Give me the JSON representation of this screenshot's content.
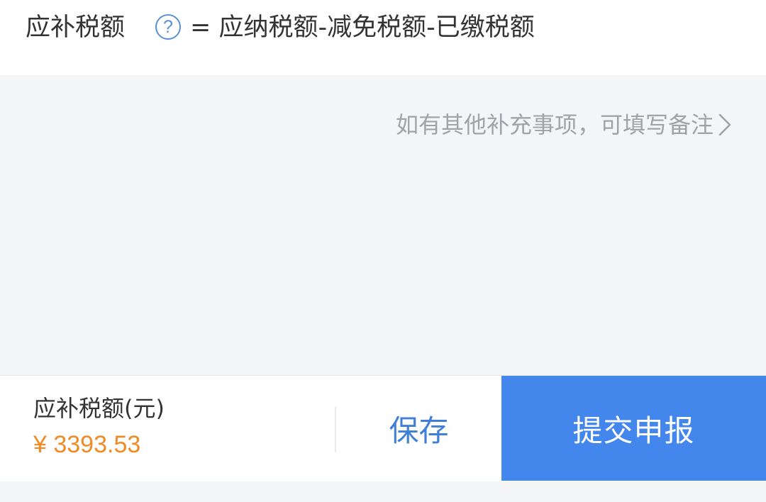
{
  "formula": {
    "title": "应补税额",
    "help_symbol": "?",
    "expression": "= 应纳税额-减免税额-已缴税额"
  },
  "note": {
    "link_text": "如有其他补充事项，可填写备注",
    "icon": "chevron-right-icon"
  },
  "footer": {
    "amount_label": "应补税额(元)",
    "amount_value": "¥ 3393.53",
    "save_label": "保存",
    "submit_label": "提交申报"
  },
  "colors": {
    "accent_blue": "#4386ec",
    "link_blue": "#3f7fd9",
    "amount_orange": "#f08a24",
    "muted_gray": "#a0a3a8",
    "background": "#f4f5f7"
  }
}
